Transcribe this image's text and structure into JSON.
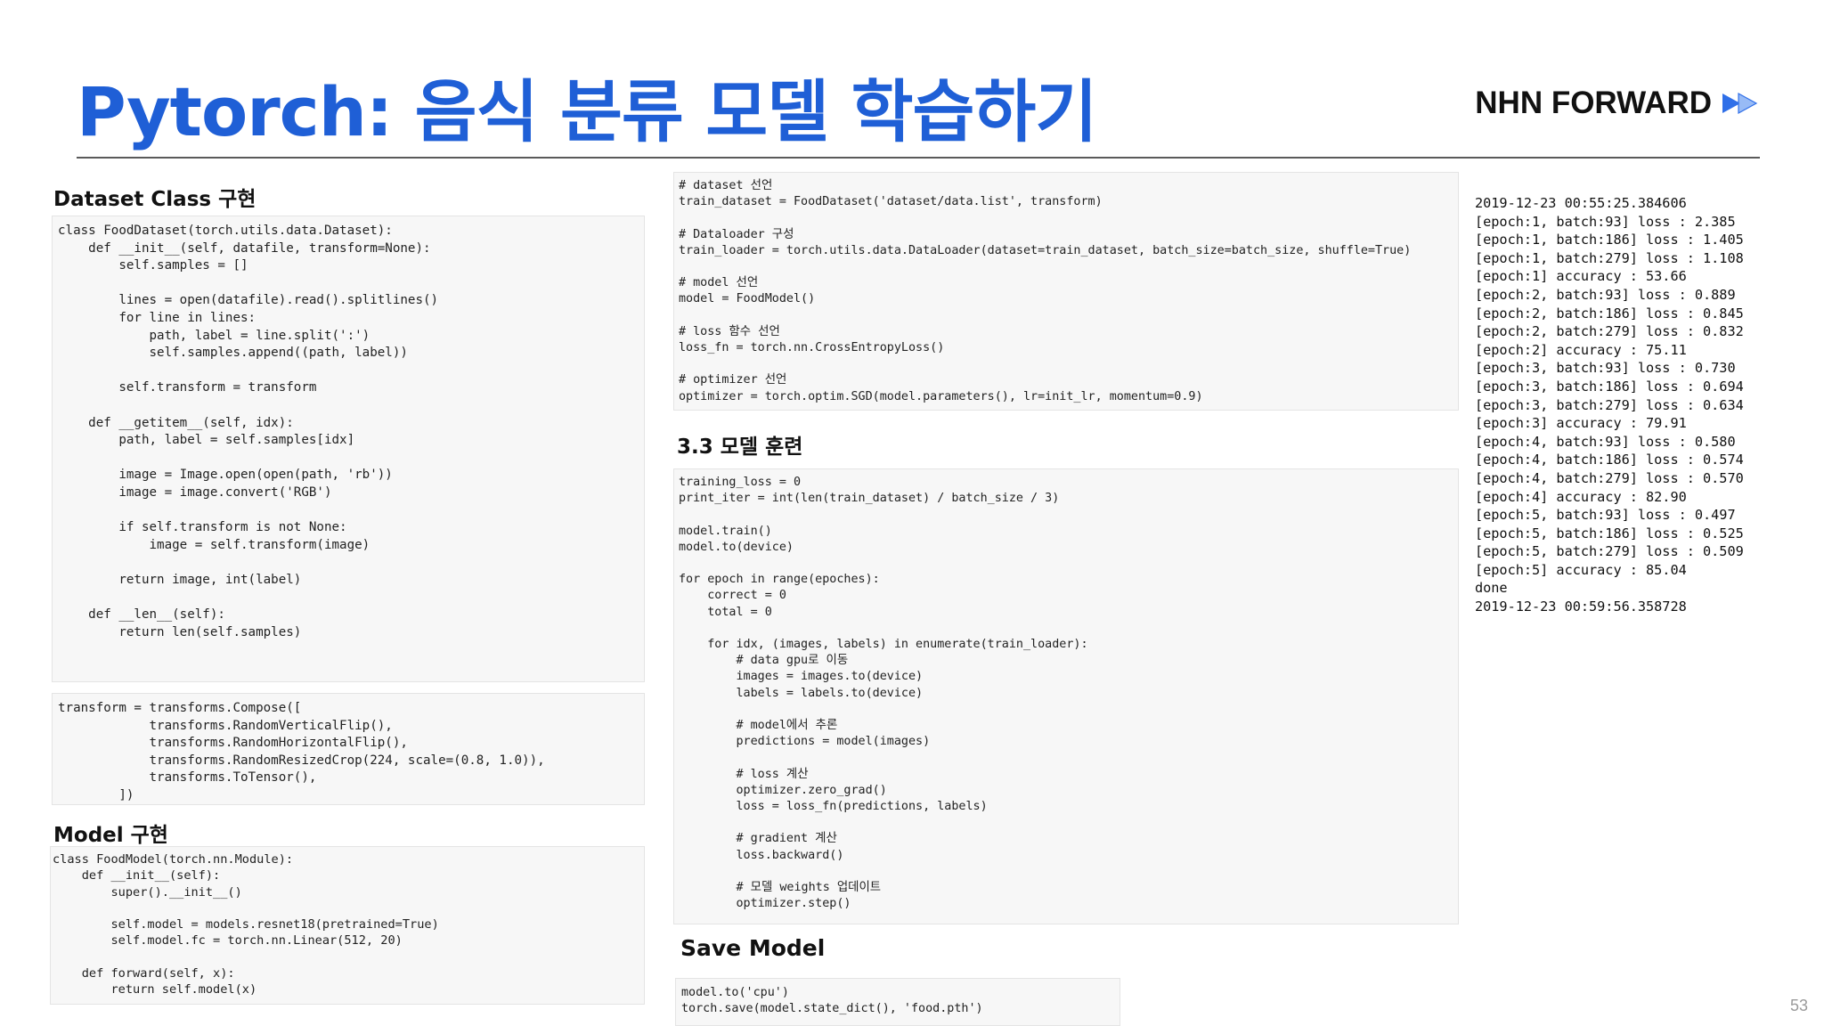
{
  "slide": {
    "title": "Pytorch: 음식 분류 모델 학습하기",
    "brand": "NHN FORWARD",
    "brand_color": "#3a7bf0",
    "title_color": "#1f5fd6",
    "page_number": "53"
  },
  "headings": {
    "dataset_class": "Dataset Class 구현",
    "model": "Model 구현",
    "training": "3.3 모델 훈련",
    "save_model": "Save Model"
  },
  "code": {
    "dataset_class": "class FoodDataset(torch.utils.data.Dataset):\n    def __init__(self, datafile, transform=None):\n        self.samples = []\n\n        lines = open(datafile).read().splitlines()\n        for line in lines:\n            path, label = line.split(':')\n            self.samples.append((path, label))\n\n        self.transform = transform\n\n    def __getitem__(self, idx):\n        path, label = self.samples[idx]\n\n        image = Image.open(open(path, 'rb'))\n        image = image.convert('RGB')\n\n        if self.transform is not None:\n            image = self.transform(image)\n\n        return image, int(label)\n\n    def __len__(self):\n        return len(self.samples)",
    "transform": "transform = transforms.Compose([\n            transforms.RandomVerticalFlip(),\n            transforms.RandomHorizontalFlip(),\n            transforms.RandomResizedCrop(224, scale=(0.8, 1.0)),\n            transforms.ToTensor(),\n        ])",
    "model": "class FoodModel(torch.nn.Module):\n    def __init__(self):\n        super().__init__()\n\n        self.model = models.resnet18(pretrained=True)\n        self.model.fc = torch.nn.Linear(512, 20)\n\n    def forward(self, x):\n        return self.model(x)",
    "setup": "# dataset 선언\ntrain_dataset = FoodDataset('dataset/data.list', transform)\n\n# Dataloader 구성\ntrain_loader = torch.utils.data.DataLoader(dataset=train_dataset, batch_size=batch_size, shuffle=True)\n\n# model 선언\nmodel = FoodModel()\n\n# loss 함수 선언\nloss_fn = torch.nn.CrossEntropyLoss()\n\n# optimizer 선언\noptimizer = torch.optim.SGD(model.parameters(), lr=init_lr, momentum=0.9)",
    "training": "training_loss = 0\nprint_iter = int(len(train_dataset) / batch_size / 3)\n\nmodel.train()\nmodel.to(device)\n\nfor epoch in range(epoches):\n    correct = 0\n    total = 0\n\n    for idx, (images, labels) in enumerate(train_loader):\n        # data gpu로 이동\n        images = images.to(device)\n        labels = labels.to(device)\n\n        # model에서 추론\n        predictions = model(images)\n\n        # loss 계산\n        optimizer.zero_grad()\n        loss = loss_fn(predictions, labels)\n\n        # gradient 계산\n        loss.backward()\n\n        # 모델 weights 업데이트\n        optimizer.step()",
    "save_model": "model.to('cpu')\ntorch.save(model.state_dict(), 'food.pth')"
  },
  "training_log": "2019-12-23 00:55:25.384606\n[epoch:1, batch:93] loss : 2.385\n[epoch:1, batch:186] loss : 1.405\n[epoch:1, batch:279] loss : 1.108\n[epoch:1] accuracy : 53.66\n[epoch:2, batch:93] loss : 0.889\n[epoch:2, batch:186] loss : 0.845\n[epoch:2, batch:279] loss : 0.832\n[epoch:2] accuracy : 75.11\n[epoch:3, batch:93] loss : 0.730\n[epoch:3, batch:186] loss : 0.694\n[epoch:3, batch:279] loss : 0.634\n[epoch:3] accuracy : 79.91\n[epoch:4, batch:93] loss : 0.580\n[epoch:4, batch:186] loss : 0.574\n[epoch:4, batch:279] loss : 0.570\n[epoch:4] accuracy : 82.90\n[epoch:5, batch:93] loss : 0.497\n[epoch:5, batch:186] loss : 0.525\n[epoch:5, batch:279] loss : 0.509\n[epoch:5] accuracy : 85.04\ndone\n2019-12-23 00:59:56.358728"
}
